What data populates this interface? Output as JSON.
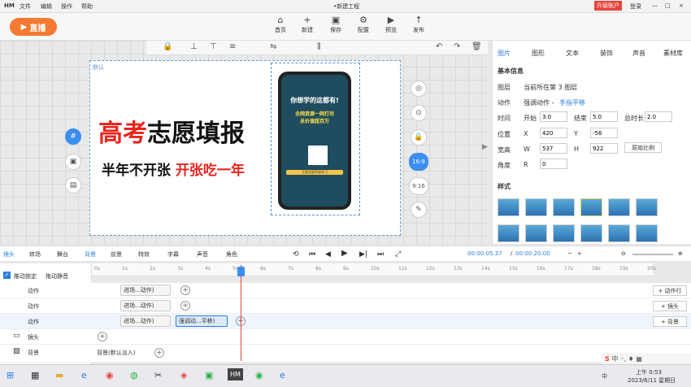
{
  "menubar": {
    "logo": "HM",
    "items": [
      "文件",
      "编辑",
      "操作",
      "帮助"
    ],
    "title": "•新建工程",
    "upgrade": "升级账户",
    "login": "登录",
    "win_min": "—",
    "win_max": "□",
    "win_close": "×"
  },
  "live_label": "直播",
  "toolbar": [
    {
      "icon": "⌂",
      "label": "首页"
    },
    {
      "icon": "+",
      "label": "新建"
    },
    {
      "icon": "▣",
      "label": "保存"
    },
    {
      "icon": "⚙",
      "label": "配置"
    },
    {
      "icon": "▶",
      "label": "预览"
    },
    {
      "icon": "↑",
      "label": "发布"
    }
  ],
  "stage": {
    "default_label": "默认",
    "headline_red": "高考",
    "headline_black": "志愿填报",
    "sub_black": "半年不开张",
    "sub_red": "开张吃一年",
    "phone": {
      "line1": "你想学的这都有!",
      "line2": "全网资源一网打尽",
      "line3": "总价值超百万",
      "btn": "立即注册开始学习"
    }
  },
  "side_buttons": [
    "#",
    "▣",
    "▤"
  ],
  "right_side": [
    "◎",
    "⊙",
    "🔒",
    "16:9",
    "9:16",
    "✎"
  ],
  "panel": {
    "tabs": [
      "图片",
      "图形",
      "文本",
      "装饰",
      "声音",
      "素材库"
    ],
    "section": "基本信息",
    "layer_label": "图层",
    "layer_value_prefix": "当前所在第",
    "layer_value": "3",
    "layer_suffix": "图层",
    "action_label": "动作",
    "action_value": "强调动作 -",
    "action_link": "手指平移",
    "time_label": "时间",
    "start_label": "开始",
    "start": "3.0",
    "end_label": "结束",
    "end": "5.0",
    "total_label": "总时长",
    "total": "2.0",
    "pos_label": "位置",
    "x_label": "X",
    "x": "420",
    "y_label": "Y",
    "y": "-56",
    "size_label": "宽高",
    "w_label": "W",
    "w": "537",
    "h_label": "H",
    "h": "922",
    "ratio_btn": "原始比例",
    "angle_label": "角度",
    "r_label": "R",
    "r": "0",
    "style_label": "样式"
  },
  "timeline": {
    "tools": [
      "镜头",
      "转场",
      "舞台",
      "背景",
      "前景",
      "特效",
      "字幕",
      "声音",
      "角色"
    ],
    "time_current": "00:00:05.37",
    "time_total": "00:00:20.00",
    "ruler": [
      "0s",
      "1s",
      "2s",
      "3s",
      "4s",
      "5s",
      "6s",
      "7s",
      "8s",
      "9s",
      "10s",
      "11s",
      "12s",
      "13s",
      "14s",
      "15s",
      "16s",
      "17s",
      "18s",
      "19s",
      "20s"
    ],
    "lock_label": "推动锁定",
    "mute_label": "拖动静音",
    "rows": [
      {
        "label": "动作",
        "clip": "进场...动作)"
      },
      {
        "label": "动作",
        "clip": "进场...动作)"
      },
      {
        "label": "动作",
        "clip": "进场...动作)",
        "clip2": "强调动...平移)"
      },
      {
        "label": "镜头"
      },
      {
        "label": "背景",
        "clip": "背景(默认淡入)"
      }
    ],
    "right_btns": [
      "+ 动作行",
      "+ 镜头",
      "+ 背景"
    ]
  },
  "taskbar": {
    "time": "上午 0:53",
    "date": "2023/6/11 星期日",
    "ime": "中",
    "tray": "中 ◦, ♦ ▦"
  }
}
